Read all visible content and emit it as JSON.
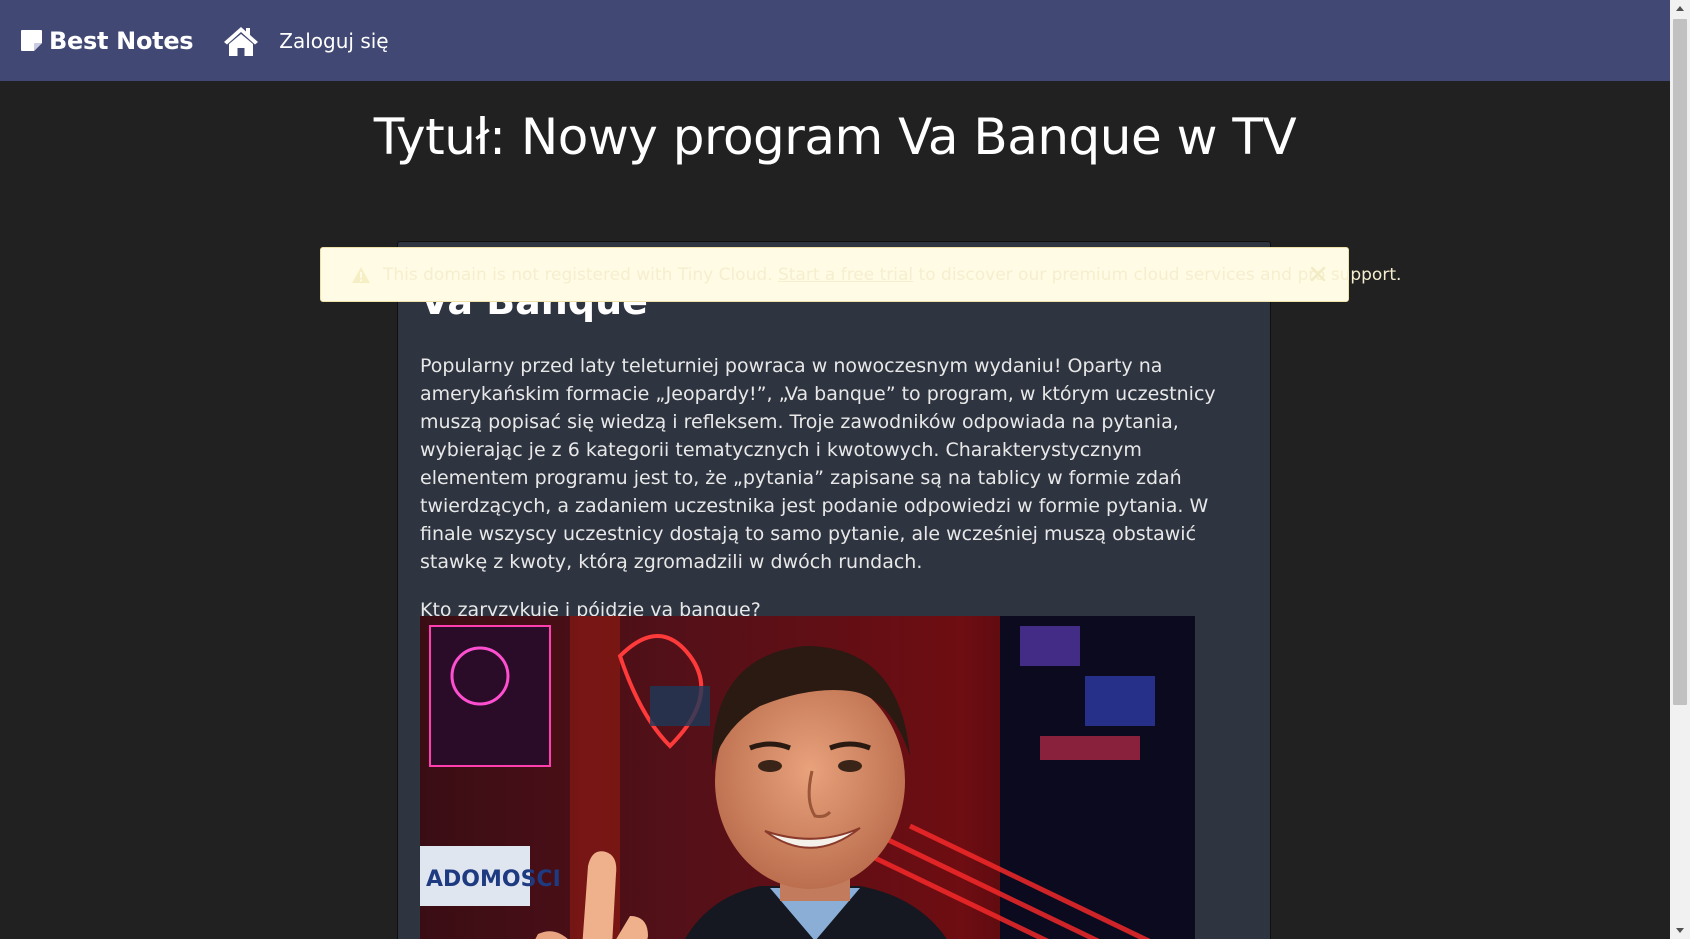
{
  "navbar": {
    "brand": "Best Notes",
    "login": "Zaloguj się",
    "background": "#424874"
  },
  "page": {
    "title": "Tytuł: Nowy program Va Banque w TV"
  },
  "note": {
    "heading": "Va Banque",
    "paragraphs": [
      "Popularny przed laty teleturniej powraca w nowoczesnym wydaniu! Oparty na amerykańskim formacie „Jeopardy!”, „Va banque” to program, w którym uczestnicy muszą popisać się wiedzą i refleksem. Troje zawodników odpowiada na pytania, wybierając je z 6 kategorii tematycznych i kwotowych. Charakterystycznym elementem programu jest to, że „pytania” zapisane są na tablicy w formie zdań twierdzących, a zadaniem uczestnika jest podanie odpowiedzi w formie pytania. W finale wszyscy uczestnicy dostają to samo pytanie, ale wcześniej muszą obstawić stawkę z kwoty, którą zgromadzili w dwóch rundach.",
      "Kto zaryzykuje i pójdzie va banque?"
    ],
    "image_text": "ADOMOSCI"
  },
  "warning": {
    "text_before": "This domain is not registered with Tiny Cloud. ",
    "link": "Start a free trial",
    "text_after": " to discover our premium cloud services and pro support."
  },
  "icons": {
    "brand": "sticky-note-icon",
    "home": "home-icon",
    "warning": "warning-triangle-icon",
    "close": "close-icon"
  }
}
